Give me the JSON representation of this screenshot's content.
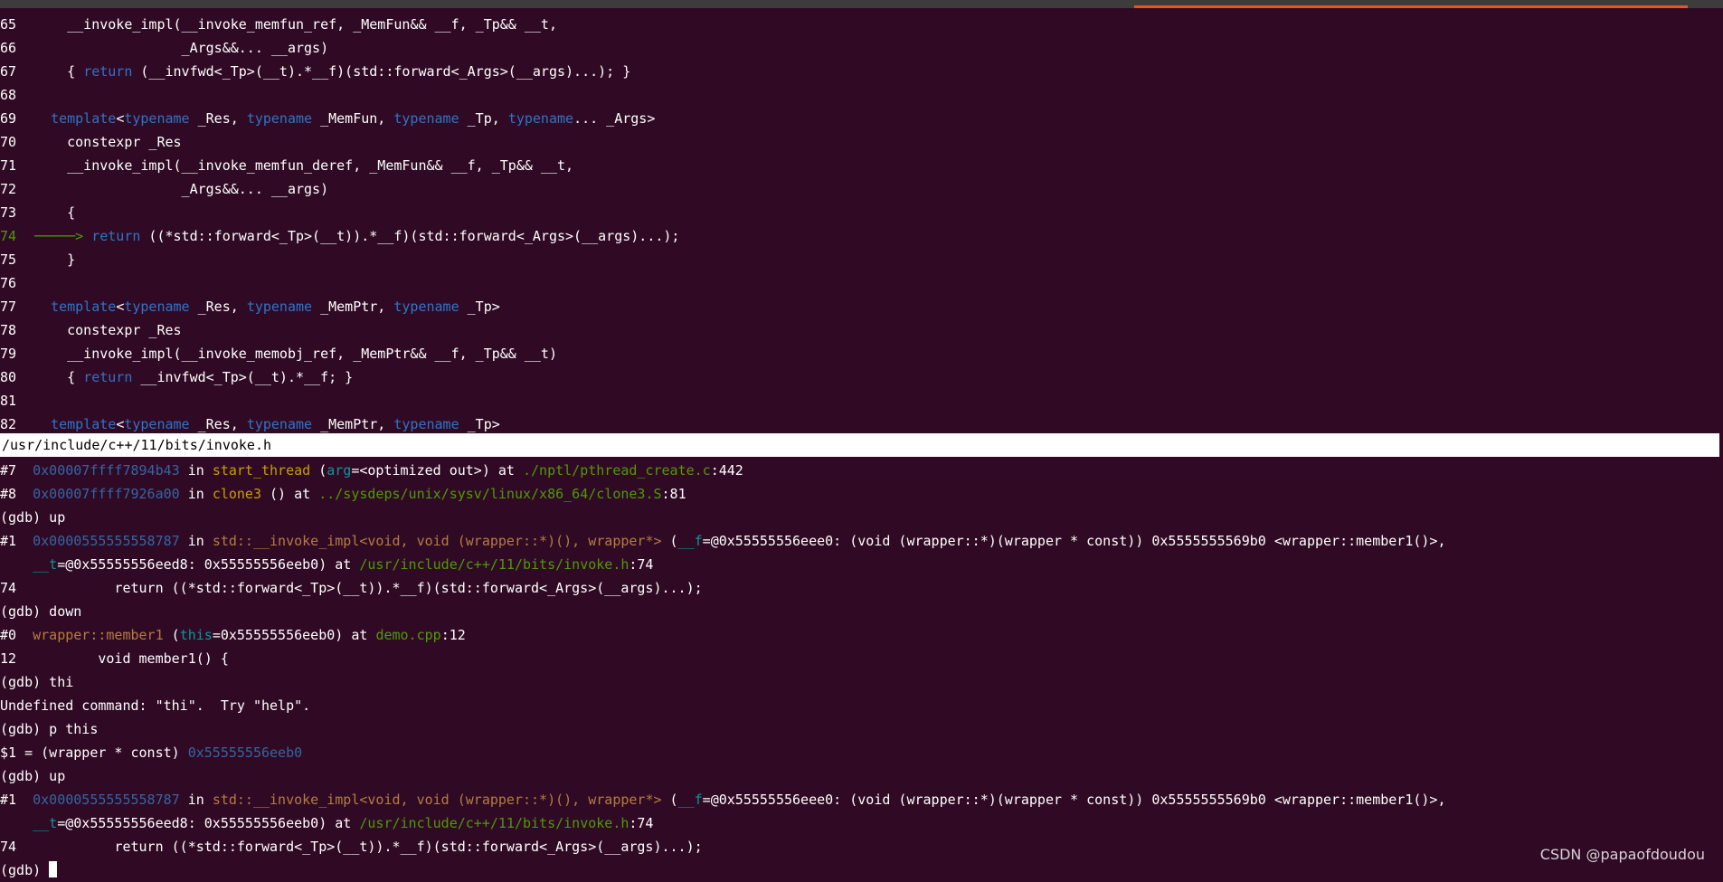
{
  "source_view": {
    "lines": [
      {
        "num": "65",
        "parts": [
          {
            "t": "    __invoke_impl(__invoke_memfun_ref, _MemFun&& __f, _Tp&& __t,"
          }
        ]
      },
      {
        "num": "66",
        "parts": [
          {
            "t": "                  _Args&&... __args)"
          }
        ]
      },
      {
        "num": "67",
        "parts": [
          {
            "t": "    { "
          },
          {
            "t": "return",
            "c": "kw"
          },
          {
            "t": " (__invfwd<_Tp>(__t).*__f)(std::forward<_Args>(__args)...); }"
          }
        ]
      },
      {
        "num": "68",
        "parts": []
      },
      {
        "num": "69",
        "parts": [
          {
            "t": "  "
          },
          {
            "t": "template",
            "c": "kw"
          },
          {
            "t": "<"
          },
          {
            "t": "typename",
            "c": "kw"
          },
          {
            "t": " _Res, "
          },
          {
            "t": "typename",
            "c": "kw"
          },
          {
            "t": " _MemFun, "
          },
          {
            "t": "typename",
            "c": "kw"
          },
          {
            "t": " _Tp, "
          },
          {
            "t": "typename",
            "c": "kw"
          },
          {
            "t": "... _Args>"
          }
        ]
      },
      {
        "num": "70",
        "parts": [
          {
            "t": "    constexpr _Res"
          }
        ]
      },
      {
        "num": "71",
        "parts": [
          {
            "t": "    __invoke_impl(__invoke_memfun_deref, _MemFun&& __f, _Tp&& __t,"
          }
        ]
      },
      {
        "num": "72",
        "parts": [
          {
            "t": "                  _Args&&... __args)"
          }
        ]
      },
      {
        "num": "73",
        "parts": [
          {
            "t": "    {"
          }
        ]
      },
      {
        "num": "74",
        "current": true,
        "parts": [
          {
            "t": "─────> ",
            "c": "arrow"
          },
          {
            "t": "return",
            "c": "kw"
          },
          {
            "t": " ((*std::forward<_Tp>(__t)).*__f)(std::forward<_Args>(__args)...);"
          }
        ]
      },
      {
        "num": "75",
        "parts": [
          {
            "t": "    }"
          }
        ]
      },
      {
        "num": "76",
        "parts": []
      },
      {
        "num": "77",
        "parts": [
          {
            "t": "  "
          },
          {
            "t": "template",
            "c": "kw"
          },
          {
            "t": "<"
          },
          {
            "t": "typename",
            "c": "kw"
          },
          {
            "t": " _Res, "
          },
          {
            "t": "typename",
            "c": "kw"
          },
          {
            "t": " _MemPtr, "
          },
          {
            "t": "typename",
            "c": "kw"
          },
          {
            "t": " _Tp>"
          }
        ]
      },
      {
        "num": "78",
        "parts": [
          {
            "t": "    constexpr _Res"
          }
        ]
      },
      {
        "num": "79",
        "parts": [
          {
            "t": "    __invoke_impl(__invoke_memobj_ref, _MemPtr&& __f, _Tp&& __t)"
          }
        ]
      },
      {
        "num": "80",
        "parts": [
          {
            "t": "    { "
          },
          {
            "t": "return",
            "c": "kw"
          },
          {
            "t": " __invfwd<_Tp>(__t).*__f; }"
          }
        ]
      },
      {
        "num": "81",
        "parts": []
      },
      {
        "num": "82",
        "parts": [
          {
            "t": "  "
          },
          {
            "t": "template",
            "c": "kw"
          },
          {
            "t": "<"
          },
          {
            "t": "typename",
            "c": "kw"
          },
          {
            "t": " _Res, "
          },
          {
            "t": "typename",
            "c": "kw"
          },
          {
            "t": " _MemPtr, "
          },
          {
            "t": "typename",
            "c": "kw"
          },
          {
            "t": " _Tp>"
          }
        ]
      }
    ]
  },
  "status_bar": {
    "file_path": "/usr/include/c++/11/bits/invoke.h"
  },
  "gdb_console": {
    "lines": [
      [
        {
          "t": "#7  "
        },
        {
          "t": "0x00007ffff7894b43",
          "c": "addr"
        },
        {
          "t": " in "
        },
        {
          "t": "start_thread",
          "c": "func"
        },
        {
          "t": " ("
        },
        {
          "t": "arg",
          "c": "var"
        },
        {
          "t": "=<optimized out>) at "
        },
        {
          "t": "./nptl/pthread_create.c",
          "c": "path"
        },
        {
          "t": ":442"
        }
      ],
      [
        {
          "t": "#8  "
        },
        {
          "t": "0x00007ffff7926a00",
          "c": "addr"
        },
        {
          "t": " in "
        },
        {
          "t": "clone3",
          "c": "func"
        },
        {
          "t": " () at "
        },
        {
          "t": "../sysdeps/unix/sysv/linux/x86_64/clone3.S",
          "c": "path"
        },
        {
          "t": ":81"
        }
      ],
      [
        {
          "t": "(gdb) up"
        }
      ],
      [
        {
          "t": "#1  "
        },
        {
          "t": "0x0000555555558787",
          "c": "addr"
        },
        {
          "t": " in "
        },
        {
          "t": "std::__invoke_impl<void, void (wrapper::*)(), wrapper*>",
          "c": "brown"
        },
        {
          "t": " ("
        },
        {
          "t": "__f",
          "c": "var"
        },
        {
          "t": "=@0x55555556eee0: (void (wrapper::*)(wrapper * const)) 0x5555555569b0 <wrapper::member1()>,"
        }
      ],
      [
        {
          "t": "    "
        },
        {
          "t": "__t",
          "c": "var"
        },
        {
          "t": "=@0x55555556eed8: 0x55555556eeb0) at "
        },
        {
          "t": "/usr/include/c++/11/bits/invoke.h",
          "c": "path"
        },
        {
          "t": ":74"
        }
      ],
      [
        {
          "t": "74            return ((*std::forward<_Tp>(__t)).*__f)(std::forward<_Args>(__args)...);"
        }
      ],
      [
        {
          "t": "(gdb) down"
        }
      ],
      [
        {
          "t": "#0  "
        },
        {
          "t": "wrapper::member1",
          "c": "brown"
        },
        {
          "t": " ("
        },
        {
          "t": "this",
          "c": "var"
        },
        {
          "t": "=0x55555556eeb0) at "
        },
        {
          "t": "demo.cpp",
          "c": "path"
        },
        {
          "t": ":12"
        }
      ],
      [
        {
          "t": "12          void member1() {"
        }
      ],
      [
        {
          "t": "(gdb) thi"
        }
      ],
      [
        {
          "t": "Undefined command: \"thi\".  Try \"help\"."
        }
      ],
      [
        {
          "t": "(gdb) p this"
        }
      ],
      [
        {
          "t": "$1 = (wrapper * const) "
        },
        {
          "t": "0x55555556eeb0",
          "c": "addr"
        }
      ],
      [
        {
          "t": "(gdb) up"
        }
      ],
      [
        {
          "t": "#1  "
        },
        {
          "t": "0x0000555555558787",
          "c": "addr"
        },
        {
          "t": " in "
        },
        {
          "t": "std::__invoke_impl<void, void (wrapper::*)(), wrapper*>",
          "c": "brown"
        },
        {
          "t": " ("
        },
        {
          "t": "__f",
          "c": "var"
        },
        {
          "t": "=@0x55555556eee0: (void (wrapper::*)(wrapper * const)) 0x5555555569b0 <wrapper::member1()>,"
        }
      ],
      [
        {
          "t": "    "
        },
        {
          "t": "__t",
          "c": "var"
        },
        {
          "t": "=@0x55555556eed8: 0x55555556eeb0) at "
        },
        {
          "t": "/usr/include/c++/11/bits/invoke.h",
          "c": "path"
        },
        {
          "t": ":74"
        }
      ],
      [
        {
          "t": "74            return ((*std::forward<_Tp>(__t)).*__f)(std::forward<_Args>(__args)...);"
        }
      ]
    ],
    "prompt": "(gdb) "
  },
  "watermark": "CSDN @papaofdoudou",
  "colors": {
    "background": "#300a24",
    "keyword": "#2e74c8",
    "address": "#3465a4",
    "path": "#4e9a06",
    "variable": "#06989a",
    "function": "#c4a000",
    "accent": "#e95420"
  }
}
